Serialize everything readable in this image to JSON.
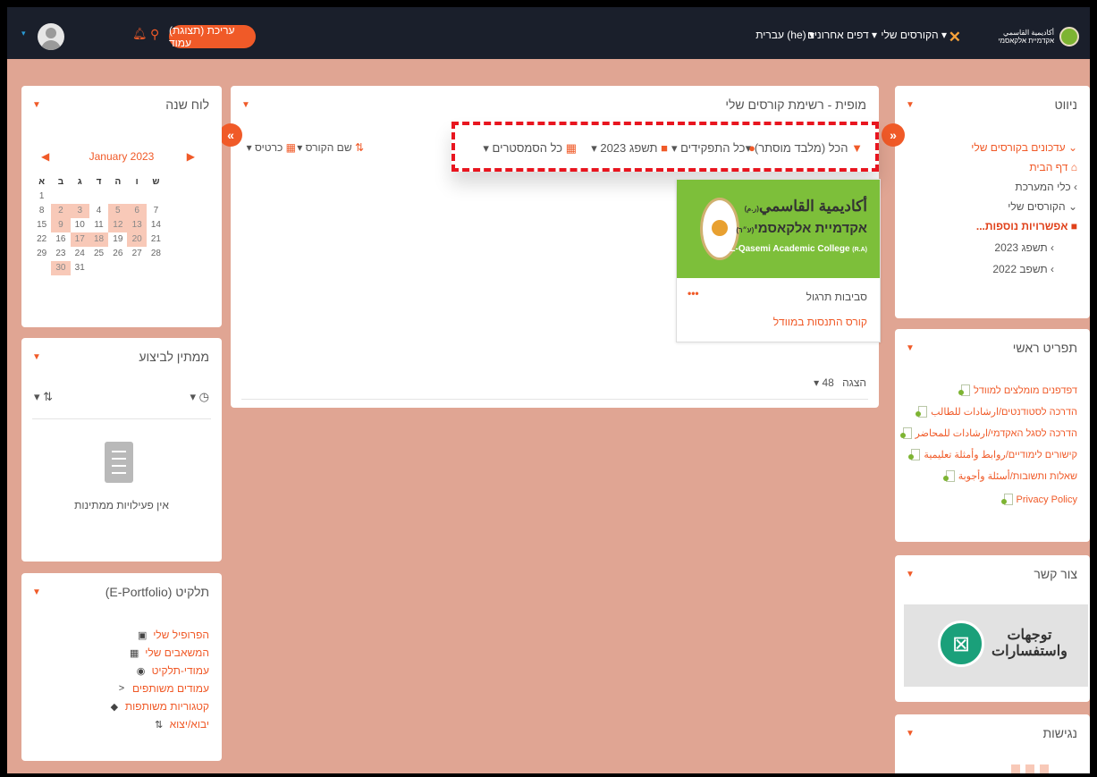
{
  "topbar": {
    "logo_line1": "أكاديمية القاسمي",
    "logo_line2": "אקדמיית אלקאסמי",
    "nav_my_courses": "הקורסים שלי",
    "nav_other_pages": "דפים אחרונים",
    "nav_language": "עברית (he)",
    "edit_button": "עריכת (תצוגת) עמוד"
  },
  "nav_block": {
    "title": "ניווט",
    "items": [
      {
        "label": "עדכונים בקורסים שלי",
        "prefix": "⌄"
      },
      {
        "label": "דף הבית",
        "prefix": "🏠"
      },
      {
        "label": "כלי המערכת",
        "prefix": "›"
      },
      {
        "label": "הקורסים שלי",
        "prefix": "⌄"
      },
      {
        "label": "אפשרויות נוספות...",
        "prefix": "■"
      },
      {
        "label": "תשפג 2023",
        "prefix": "›"
      },
      {
        "label": "תשפב 2022",
        "prefix": "›"
      }
    ]
  },
  "main_menu": {
    "title": "תפריט ראשי",
    "items": [
      "דפדפנים מומלצים למוודל",
      "הדרכה לסטודנטים/ارشادات للطالب",
      "הדרכה לסגל האקדמי/ارشادات للمحاضر",
      "קישורים לימודיים/روابط وأمثلة تعليمية",
      "שאלות ותשובות/أسئلة وأجوبة",
      "Privacy Policy"
    ]
  },
  "contact": {
    "title": "צור קשר",
    "line1": "توجهات",
    "line2": "واستفسارات"
  },
  "access": {
    "title": "נגישות"
  },
  "course_overview": {
    "title": "מופית - רשימת קורסים שלי",
    "filters": {
      "all": "הכל (מלבד מוסתר)",
      "roles": "כל התפקידים",
      "year": "תשפג 2023",
      "semesters": "כל הסמסטרים"
    },
    "sort": "שם הקורס",
    "view": "כרטיס",
    "course": {
      "name_ar": "أكاديمية القاسمي",
      "name_ar_suffix": "(ر.م)",
      "name_he": "אקדמיית אלקאסמי",
      "name_he_suffix": "(ע״ר)",
      "name_en": "AL-Qasemi Academic College",
      "name_en_suffix": "(R.A)",
      "category": "סביבות תרגול",
      "link": "קורס התנסות במוודל",
      "menu": "•••"
    },
    "show_label": "הצגה",
    "show_value": "48"
  },
  "calendar": {
    "title": "לוח שנה",
    "month": "January 2023",
    "day_names": [
      "א",
      "ב",
      "ג",
      "ד",
      "ה",
      "ו",
      "ש"
    ],
    "weeks": [
      [
        "1",
        "",
        "",
        "",
        "",
        "",
        ""
      ],
      [
        "8",
        "2",
        "3",
        "4",
        "5",
        "6",
        "7"
      ],
      [
        "15",
        "9",
        "10",
        "11",
        "12",
        "13",
        "14"
      ],
      [
        "22",
        "16",
        "17",
        "18",
        "19",
        "20",
        "21"
      ],
      [
        "29",
        "23",
        "24",
        "25",
        "26",
        "27",
        "28"
      ],
      [
        "",
        "30",
        "31",
        "",
        "",
        "",
        ""
      ]
    ]
  },
  "timeline": {
    "title": "ממתין לביצוע",
    "empty": "אין פעילויות ממתינות"
  },
  "portfolio": {
    "title": "תלקיט (E-Portfolio)",
    "items": [
      {
        "label": "הפרופיל שלי",
        "icon": "▣"
      },
      {
        "label": "המשאבים שלי",
        "icon": "▦"
      },
      {
        "label": "עמודי-תלקיט",
        "icon": "◉"
      },
      {
        "label": "עמודים משותפים",
        "icon": "<"
      },
      {
        "label": "קטגוריות משותפות",
        "icon": "◆"
      },
      {
        "label": "יבוא/יצוא",
        "icon": "⇅"
      }
    ]
  },
  "colors": {
    "accent": "#f05a28",
    "page_bg": "#e0a593",
    "topbar_bg": "#1a1f2b"
  }
}
